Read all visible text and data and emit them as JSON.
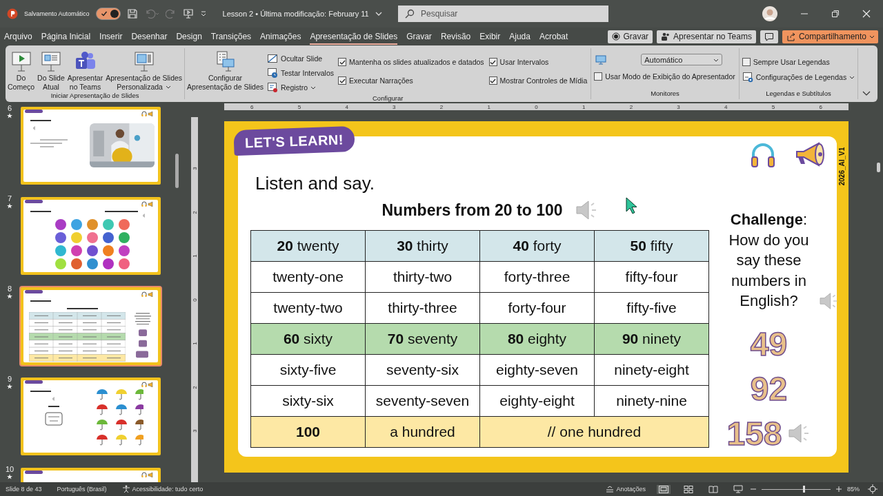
{
  "title_bar": {
    "autosave_label": "Salvamento Automático",
    "autosave_on": true,
    "document_title": "Lesson 2 • Última modificação: February 11",
    "search": {
      "placeholder": "Pesquisar"
    }
  },
  "menu_tabs": [
    {
      "label": "Arquivo",
      "selected": false
    },
    {
      "label": "Página Inicial",
      "selected": false
    },
    {
      "label": "Inserir",
      "selected": false
    },
    {
      "label": "Desenhar",
      "selected": false
    },
    {
      "label": "Design",
      "selected": false
    },
    {
      "label": "Transições",
      "selected": false
    },
    {
      "label": "Animações",
      "selected": false
    },
    {
      "label": "Apresentação de Slides",
      "selected": true
    },
    {
      "label": "Gravar",
      "selected": false
    },
    {
      "label": "Revisão",
      "selected": false
    },
    {
      "label": "Exibir",
      "selected": false
    },
    {
      "label": "Ajuda",
      "selected": false
    },
    {
      "label": "Acrobat",
      "selected": false
    }
  ],
  "header_buttons": [
    {
      "kind": "record",
      "label": "Gravar"
    },
    {
      "kind": "teams",
      "label": "Apresentar no Teams"
    },
    {
      "kind": "comment"
    },
    {
      "kind": "share",
      "label": "Compartilhamento"
    }
  ],
  "ribbon": {
    "groups": [
      {
        "label": "Iniciar Apresentação de Slides",
        "columns": [
          [
            {
              "kind": "large",
              "label": "Do\nComeço"
            }
          ],
          [
            {
              "kind": "large",
              "label": "Do Slide\nAtual"
            }
          ],
          [
            {
              "kind": "large",
              "label": "Apresentar\nno Teams"
            }
          ],
          [
            {
              "kind": "large",
              "label": "Apresentação de Slides\nPersonalizada",
              "dropdown": true
            }
          ]
        ]
      },
      {
        "label": "Configurar",
        "columns": [
          [
            {
              "kind": "large",
              "label": "Configurar\nApresentação de Slides"
            }
          ],
          [
            {
              "kind": "small",
              "label": "Ocultar Slide"
            },
            {
              "kind": "small",
              "label": "Testar Intervalos"
            },
            {
              "kind": "small",
              "label": "Registro",
              "dropdown": true
            }
          ],
          [
            {
              "kind": "check",
              "label": "Mantenha os slides atualizados e datados",
              "checked": true
            },
            {
              "kind": "check",
              "label": "Executar Narrações",
              "checked": true
            }
          ],
          [
            {
              "kind": "check",
              "label": "Usar Intervalos",
              "checked": true
            },
            {
              "kind": "check",
              "label": "Mostrar Controles de Mídia",
              "checked": true
            }
          ]
        ]
      },
      {
        "label": "Monitores",
        "columns": [
          [
            {
              "kind": "select",
              "value": "Automático"
            },
            {
              "kind": "check",
              "label": "Usar Modo de Exibição do Apresentador",
              "checked": false
            }
          ]
        ]
      },
      {
        "label": "Legendas e Subtítulos",
        "columns": [
          [
            {
              "kind": "check",
              "label": "Sempre Usar Legendas",
              "checked": false
            },
            {
              "kind": "small",
              "label": "Configurações de Legendas",
              "dropdown": true
            }
          ]
        ]
      }
    ]
  },
  "slides_panel": [
    {
      "number": "6",
      "starred": true,
      "selected": false
    },
    {
      "number": "7",
      "starred": true,
      "selected": false,
      "kind": "circles",
      "circles": [
        {
          "color": "#a93cc4"
        },
        {
          "color": "#3da3e2"
        },
        {
          "color": "#e0902a"
        },
        {
          "color": "#3fc8b2"
        },
        {
          "color": "#f06a5a"
        },
        {
          "color": "#6a5fd8"
        },
        {
          "color": "#f0cf30"
        },
        {
          "color": "#f07090"
        },
        {
          "color": "#4462d0"
        },
        {
          "color": "#30b060"
        },
        {
          "color": "#30b8d0"
        },
        {
          "color": "#d040b0"
        },
        {
          "color": "#7050d0"
        },
        {
          "color": "#f08020"
        },
        {
          "color": "#c040c0"
        },
        {
          "color": "#a0e040"
        },
        {
          "color": "#e06030"
        },
        {
          "color": "#3090d0"
        },
        {
          "color": "#b030c0"
        },
        {
          "color": "#f06080"
        }
      ]
    },
    {
      "number": "8",
      "starred": true,
      "selected": true,
      "kind": "table"
    },
    {
      "number": "9",
      "starred": true,
      "selected": false,
      "kind": "colors"
    },
    {
      "number": "10",
      "starred": true,
      "selected": false,
      "kind": "blank"
    }
  ],
  "rulers": {
    "horizontal": [
      "6",
      "5",
      "4",
      "3",
      "2",
      "1",
      "0",
      "1",
      "2",
      "3",
      "4",
      "5",
      "6"
    ],
    "vertical": [
      "3",
      "2",
      "1",
      "0",
      "1",
      "2",
      "3"
    ]
  },
  "slide": {
    "badge": "LET'S LEARN!",
    "version": "2026_AI_V1",
    "heading": "Listen and say.",
    "table_title": "Numbers from 20 to 100",
    "rows": [
      {
        "kind": "header",
        "cells": [
          {
            "text": "**20** twenty"
          },
          {
            "text": "**30** thirty"
          },
          {
            "text": "**40** forty"
          },
          {
            "text": "**50** fifty"
          }
        ]
      },
      {
        "kind": "plain",
        "cells": [
          {
            "text": "twenty-one"
          },
          {
            "text": "thirty-two"
          },
          {
            "text": "forty-three"
          },
          {
            "text": "fifty-four"
          }
        ]
      },
      {
        "kind": "plain",
        "cells": [
          {
            "text": "twenty-two"
          },
          {
            "text": "thirty-three"
          },
          {
            "text": "forty-four"
          },
          {
            "text": "fifty-five"
          }
        ]
      },
      {
        "kind": "tens",
        "cells": [
          {
            "text": "**60** sixty"
          },
          {
            "text": "**70** seventy"
          },
          {
            "text": "**80** eighty"
          },
          {
            "text": "**90** ninety"
          }
        ]
      },
      {
        "kind": "plain",
        "cells": [
          {
            "text": "sixty-five"
          },
          {
            "text": "seventy-six"
          },
          {
            "text": "eighty-seven"
          },
          {
            "text": "ninety-eight"
          }
        ]
      },
      {
        "kind": "plain",
        "cells": [
          {
            "text": "sixty-six"
          },
          {
            "text": "seventy-seven"
          },
          {
            "text": "eighty-eight"
          },
          {
            "text": "ninety-nine"
          }
        ]
      },
      {
        "kind": "total",
        "cells": [
          {
            "text": "100",
            "bold": true
          },
          {
            "text": "a hundred"
          },
          {
            "text": "// one hundred",
            "colspan": 2
          }
        ]
      }
    ],
    "challenge": {
      "text": "**Challenge**: How do you say these numbers in English?",
      "numbers": [
        {
          "text": "49",
          "audio": false
        },
        {
          "text": "92",
          "audio": false
        },
        {
          "text": "158",
          "audio": true
        }
      ]
    }
  },
  "status_bar": {
    "slide": "Slide 8 de 43",
    "language": "Português (Brasil)",
    "accessibility": "Acessibilidade: tudo certo",
    "notes": "Anotações",
    "views": [
      {
        "kind": "normal",
        "selected": true
      },
      {
        "kind": "sorter",
        "selected": false
      },
      {
        "kind": "reading",
        "selected": false
      },
      {
        "kind": "show",
        "selected": false
      }
    ],
    "zoom": {
      "level": 0.6,
      "reading": "85%"
    }
  }
}
